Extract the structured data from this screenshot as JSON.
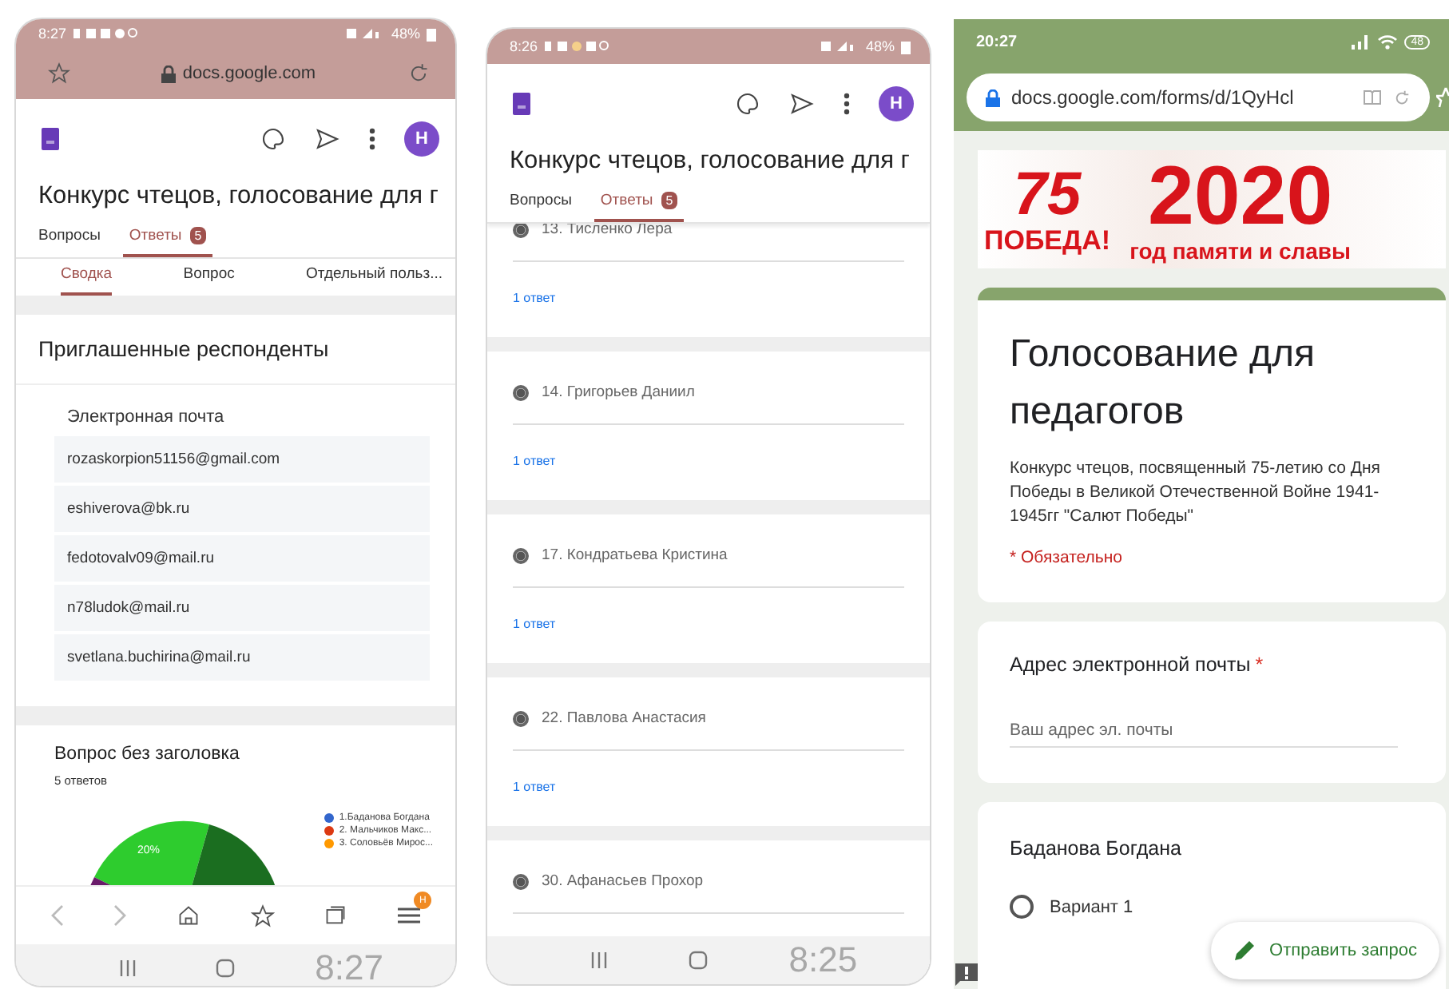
{
  "left_phone": {
    "status_bar": {
      "time": "8:27",
      "battery": "48%"
    },
    "browser": {
      "url": "docs.google.com"
    },
    "app_header": {
      "avatar": "H"
    },
    "form_title": "Конкурс чтецов, голосование для г",
    "tabs": [
      {
        "label": "Вопросы",
        "selected": false
      },
      {
        "label": "Ответы",
        "selected": true,
        "badge": "5"
      }
    ],
    "subtabs": [
      {
        "label": "Сводка",
        "selected": true
      },
      {
        "label": "Вопрос",
        "selected": false
      },
      {
        "label": "Отдельный польз...",
        "selected": false
      }
    ],
    "invited_card": {
      "title": "Приглашенные респонденты",
      "column_label": "Электронная почта",
      "emails": [
        "rozaskorpion51156@gmail.com",
        "eshiverova@bk.ru",
        "fedotovalv09@mail.ru",
        "n78ludok@mail.ru",
        "svetlana.buchirina@mail.ru"
      ]
    },
    "question_card": {
      "title": "Вопрос без заголовка",
      "count": "5 ответов",
      "slice_label": "20%",
      "legend": [
        {
          "label": "1.Баданова Богдана",
          "color": "#3366cc"
        },
        {
          "label": "2. Мальчиков Макс...",
          "color": "#dc3912"
        },
        {
          "label": "3. Соловьёв Мирос...",
          "color": "#ff9900"
        }
      ]
    },
    "bottom_toolbar": {
      "menu_badge": "H"
    },
    "nav_overlay_time": "8:27"
  },
  "middle_phone": {
    "status_bar": {
      "time": "8:26",
      "battery": "48%"
    },
    "app_header": {
      "avatar": "H"
    },
    "form_title": "Конкурс чтецов, голосование для г",
    "tabs": [
      {
        "label": "Вопросы",
        "selected": false
      },
      {
        "label": "Ответы",
        "selected": true,
        "badge": "5"
      }
    ],
    "responses": [
      {
        "label": "13. Тисленко Лера",
        "checked": true,
        "count": "1 ответ"
      },
      {
        "label": "14. Григорьев Даниил",
        "checked": true,
        "count": "1 ответ"
      },
      {
        "label": "17. Кондратьева Кристина",
        "checked": true,
        "count": "1 ответ"
      },
      {
        "label": "22. Павлова Анастасия",
        "checked": true,
        "count": "1 ответ"
      },
      {
        "label": "30. Афанасьев Прохор",
        "checked": true
      }
    ],
    "nav_overlay_time": "8:25"
  },
  "right_phone": {
    "status_bar": {
      "time": "20:27",
      "battery": "48"
    },
    "browser": {
      "url": "docs.google.com/forms/d/1QyHcl"
    },
    "banner": {
      "number": "75",
      "word": "ПОБЕДА!",
      "year": "2020",
      "motto": "год памяти и славы"
    },
    "form": {
      "title": "Голосование для педагогов",
      "description": "Конкурс чтецов, посвященный 75-летию со Дня Победы в Великой Отечественной Войне 1941-1945гг \"Салют Победы\"",
      "required_note": "* Обязательно"
    },
    "email_question": {
      "label": "Адрес электронной почты",
      "required_mark": "*",
      "placeholder": "Ваш адрес эл. почты"
    },
    "choice_question": {
      "title": "Баданова Богдана",
      "options": [
        {
          "label": "Вариант 1",
          "selected": false
        }
      ]
    },
    "fab": {
      "label": "Отправить запрос"
    }
  }
}
